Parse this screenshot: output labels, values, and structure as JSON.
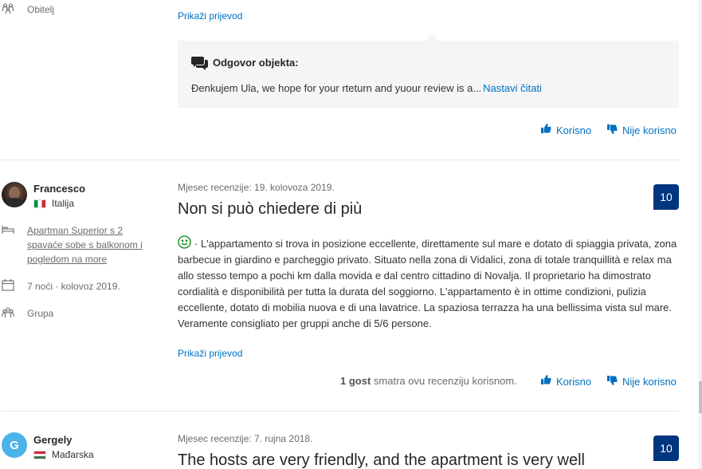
{
  "review1": {
    "traveller_type": "Obitelj",
    "translate_link": "Prikaži prijevod",
    "response": {
      "heading": "Odgovor objekta:",
      "text": "Đenkujem Ula, we hope for your rteturn and yuour review is a...",
      "continue_link": "Nastavi čitati"
    },
    "helpful_label": "Korisno",
    "not_helpful_label": "Nije korisno"
  },
  "review2": {
    "avatar_initial": "",
    "name": "Francesco",
    "country": "Italija",
    "room": "Apartman Superior s 2 spavaće sobe s balkonom i pogledom na more",
    "stay": "7 noći · kolovoz 2019.",
    "traveller_type": "Grupa",
    "review_date": "Mjesec recenzije: 19. kolovoza 2019.",
    "score": "10",
    "title": "Non si può chiedere di più",
    "body_prefix": "·",
    "body": "L'appartamento si trova in posizione eccellente, direttamente sul mare e dotato di spiaggia privata, zona barbecue in giardino e parcheggio privato. Situato nella zona di Vidalici, zona di totale tranquillità e relax ma allo stesso tempo a pochi km dalla movida e dal centro cittadino di Novalja. Il proprietario ha dimostrato cordialità e disponibilità per tutta la durata del soggiorno. L'appartamento è in ottime condizioni, pulizia eccellente, dotato di mobilia nuova e di una lavatrice. La spaziosa terrazza ha una bellissima vista sul mare. Veramente consigliato per gruppi anche di 5/6 persone.",
    "translate_link": "Prikaži prijevod",
    "helpful_count": "1 gost",
    "helpful_suffix": "smatra ovu recenziju korisnom.",
    "helpful_label": "Korisno",
    "not_helpful_label": "Nije korisno"
  },
  "review3": {
    "avatar_initial": "G",
    "name": "Gergely",
    "country": "Mađarska",
    "review_date": "Mjesec recenzije: 7. rujna 2018.",
    "score": "10",
    "title": "The hosts are very friendly, and the apartment is very well"
  },
  "colors": {
    "link": "#0071c2",
    "score_bg": "#003580",
    "response_bg": "#f5f5f5",
    "avatar_bg": "#4ab3e8",
    "positive_icon": "#008009"
  },
  "icons": [
    "family-icon",
    "speech-bubbles-icon",
    "thumbs-up-icon",
    "thumbs-down-icon",
    "bed-icon",
    "calendar-icon",
    "group-icon",
    "smiley-icon"
  ]
}
